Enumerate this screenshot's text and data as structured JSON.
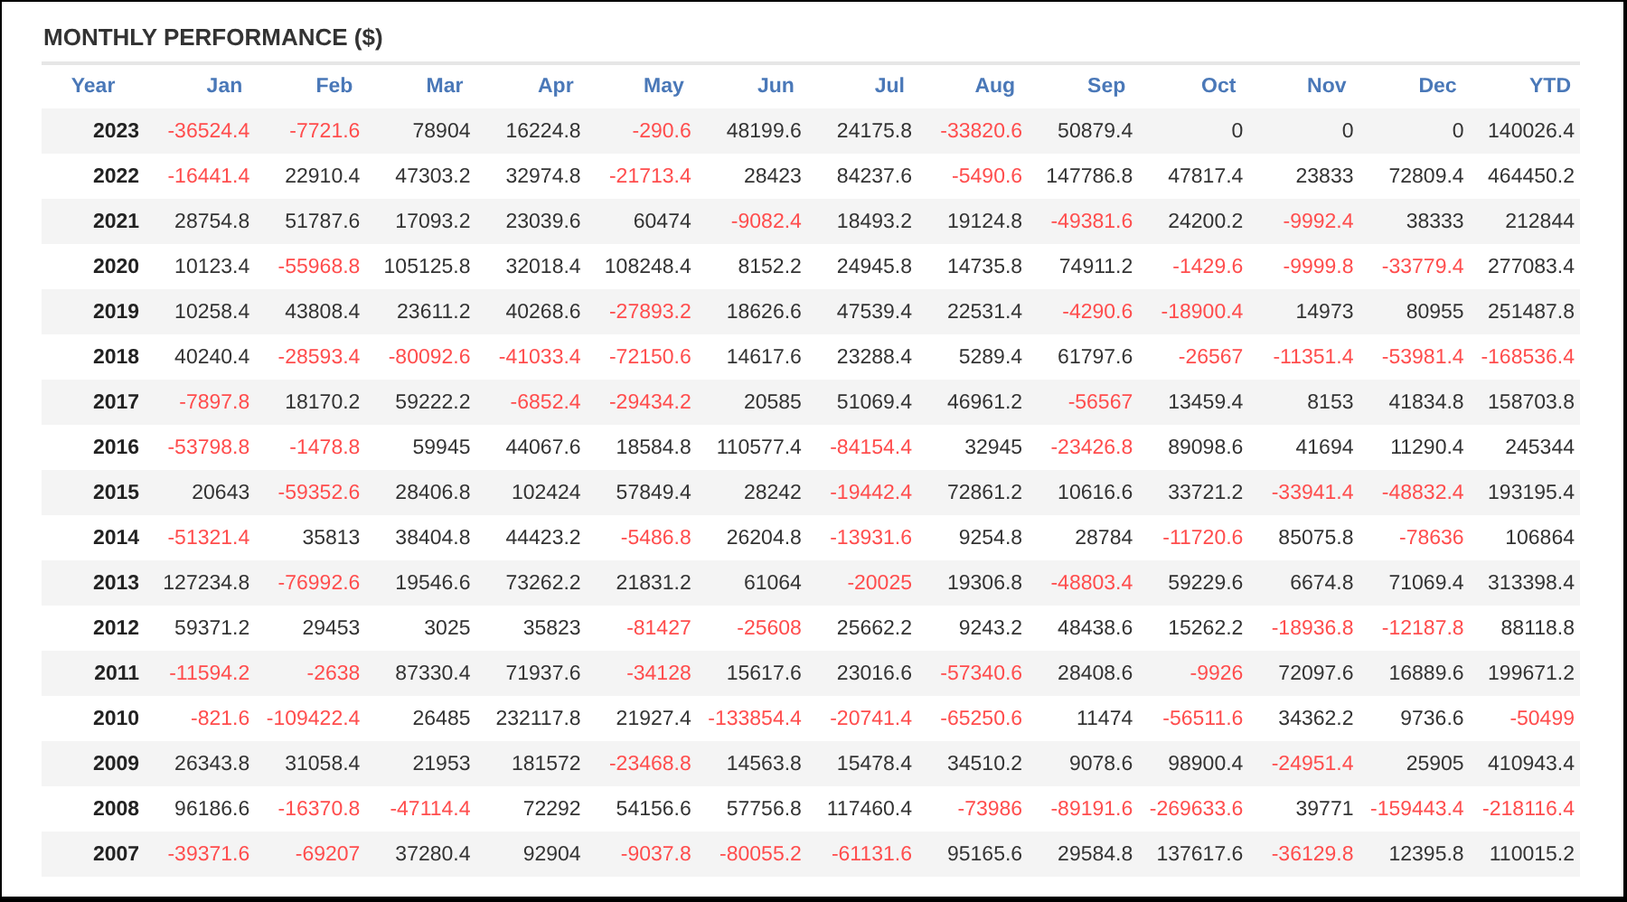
{
  "title": "MONTHLY PERFORMANCE ($)",
  "columns": [
    "Year",
    "Jan",
    "Feb",
    "Mar",
    "Apr",
    "May",
    "Jun",
    "Jul",
    "Aug",
    "Sep",
    "Oct",
    "Nov",
    "Dec",
    "YTD"
  ],
  "rows": [
    {
      "year": "2023",
      "cells": [
        {
          "text": "-36524.4",
          "negative": true
        },
        {
          "text": "-7721.6",
          "negative": true
        },
        {
          "text": "78904",
          "negative": false
        },
        {
          "text": "16224.8",
          "negative": false
        },
        {
          "text": "-290.6",
          "negative": true
        },
        {
          "text": "48199.6",
          "negative": false
        },
        {
          "text": "24175.8",
          "negative": false
        },
        {
          "text": "-33820.6",
          "negative": true
        },
        {
          "text": "50879.4",
          "negative": false
        },
        {
          "text": "0",
          "negative": false
        },
        {
          "text": "0",
          "negative": false
        },
        {
          "text": "0",
          "negative": false
        },
        {
          "text": "140026.4",
          "negative": false
        }
      ]
    },
    {
      "year": "2022",
      "cells": [
        {
          "text": "-16441.4",
          "negative": true
        },
        {
          "text": "22910.4",
          "negative": false
        },
        {
          "text": "47303.2",
          "negative": false
        },
        {
          "text": "32974.8",
          "negative": false
        },
        {
          "text": "-21713.4",
          "negative": true
        },
        {
          "text": "28423",
          "negative": false
        },
        {
          "text": "84237.6",
          "negative": false
        },
        {
          "text": "-5490.6",
          "negative": true
        },
        {
          "text": "147786.8",
          "negative": false
        },
        {
          "text": "47817.4",
          "negative": false
        },
        {
          "text": "23833",
          "negative": false
        },
        {
          "text": "72809.4",
          "negative": false
        },
        {
          "text": "464450.2",
          "negative": false
        }
      ]
    },
    {
      "year": "2021",
      "cells": [
        {
          "text": "28754.8",
          "negative": false
        },
        {
          "text": "51787.6",
          "negative": false
        },
        {
          "text": "17093.2",
          "negative": false
        },
        {
          "text": "23039.6",
          "negative": false
        },
        {
          "text": "60474",
          "negative": false
        },
        {
          "text": "-9082.4",
          "negative": true
        },
        {
          "text": "18493.2",
          "negative": false
        },
        {
          "text": "19124.8",
          "negative": false
        },
        {
          "text": "-49381.6",
          "negative": true
        },
        {
          "text": "24200.2",
          "negative": false
        },
        {
          "text": "-9992.4",
          "negative": true
        },
        {
          "text": "38333",
          "negative": false
        },
        {
          "text": "212844",
          "negative": false
        }
      ]
    },
    {
      "year": "2020",
      "cells": [
        {
          "text": "10123.4",
          "negative": false
        },
        {
          "text": "-55968.8",
          "negative": true
        },
        {
          "text": "105125.8",
          "negative": false
        },
        {
          "text": "32018.4",
          "negative": false
        },
        {
          "text": "108248.4",
          "negative": false
        },
        {
          "text": "8152.2",
          "negative": false
        },
        {
          "text": "24945.8",
          "negative": false
        },
        {
          "text": "14735.8",
          "negative": false
        },
        {
          "text": "74911.2",
          "negative": false
        },
        {
          "text": "-1429.6",
          "negative": true
        },
        {
          "text": "-9999.8",
          "negative": true
        },
        {
          "text": "-33779.4",
          "negative": true
        },
        {
          "text": "277083.4",
          "negative": false
        }
      ]
    },
    {
      "year": "2019",
      "cells": [
        {
          "text": "10258.4",
          "negative": false
        },
        {
          "text": "43808.4",
          "negative": false
        },
        {
          "text": "23611.2",
          "negative": false
        },
        {
          "text": "40268.6",
          "negative": false
        },
        {
          "text": "-27893.2",
          "negative": true
        },
        {
          "text": "18626.6",
          "negative": false
        },
        {
          "text": "47539.4",
          "negative": false
        },
        {
          "text": "22531.4",
          "negative": false
        },
        {
          "text": "-4290.6",
          "negative": true
        },
        {
          "text": "-18900.4",
          "negative": true
        },
        {
          "text": "14973",
          "negative": false
        },
        {
          "text": "80955",
          "negative": false
        },
        {
          "text": "251487.8",
          "negative": false
        }
      ]
    },
    {
      "year": "2018",
      "cells": [
        {
          "text": "40240.4",
          "negative": false
        },
        {
          "text": "-28593.4",
          "negative": true
        },
        {
          "text": "-80092.6",
          "negative": true
        },
        {
          "text": "-41033.4",
          "negative": true
        },
        {
          "text": "-72150.6",
          "negative": true
        },
        {
          "text": "14617.6",
          "negative": false
        },
        {
          "text": "23288.4",
          "negative": false
        },
        {
          "text": "5289.4",
          "negative": false
        },
        {
          "text": "61797.6",
          "negative": false
        },
        {
          "text": "-26567",
          "negative": true
        },
        {
          "text": "-11351.4",
          "negative": true
        },
        {
          "text": "-53981.4",
          "negative": true
        },
        {
          "text": "-168536.4",
          "negative": true
        }
      ]
    },
    {
      "year": "2017",
      "cells": [
        {
          "text": "-7897.8",
          "negative": true
        },
        {
          "text": "18170.2",
          "negative": false
        },
        {
          "text": "59222.2",
          "negative": false
        },
        {
          "text": "-6852.4",
          "negative": true
        },
        {
          "text": "-29434.2",
          "negative": true
        },
        {
          "text": "20585",
          "negative": false
        },
        {
          "text": "51069.4",
          "negative": false
        },
        {
          "text": "46961.2",
          "negative": false
        },
        {
          "text": "-56567",
          "negative": true
        },
        {
          "text": "13459.4",
          "negative": false
        },
        {
          "text": "8153",
          "negative": false
        },
        {
          "text": "41834.8",
          "negative": false
        },
        {
          "text": "158703.8",
          "negative": false
        }
      ]
    },
    {
      "year": "2016",
      "cells": [
        {
          "text": "-53798.8",
          "negative": true
        },
        {
          "text": "-1478.8",
          "negative": true
        },
        {
          "text": "59945",
          "negative": false
        },
        {
          "text": "44067.6",
          "negative": false
        },
        {
          "text": "18584.8",
          "negative": false
        },
        {
          "text": "110577.4",
          "negative": false
        },
        {
          "text": "-84154.4",
          "negative": true
        },
        {
          "text": "32945",
          "negative": false
        },
        {
          "text": "-23426.8",
          "negative": true
        },
        {
          "text": "89098.6",
          "negative": false
        },
        {
          "text": "41694",
          "negative": false
        },
        {
          "text": "11290.4",
          "negative": false
        },
        {
          "text": "245344",
          "negative": false
        }
      ]
    },
    {
      "year": "2015",
      "cells": [
        {
          "text": "20643",
          "negative": false
        },
        {
          "text": "-59352.6",
          "negative": true
        },
        {
          "text": "28406.8",
          "negative": false
        },
        {
          "text": "102424",
          "negative": false
        },
        {
          "text": "57849.4",
          "negative": false
        },
        {
          "text": "28242",
          "negative": false
        },
        {
          "text": "-19442.4",
          "negative": true
        },
        {
          "text": "72861.2",
          "negative": false
        },
        {
          "text": "10616.6",
          "negative": false
        },
        {
          "text": "33721.2",
          "negative": false
        },
        {
          "text": "-33941.4",
          "negative": true
        },
        {
          "text": "-48832.4",
          "negative": true
        },
        {
          "text": "193195.4",
          "negative": false
        }
      ]
    },
    {
      "year": "2014",
      "cells": [
        {
          "text": "-51321.4",
          "negative": true
        },
        {
          "text": "35813",
          "negative": false
        },
        {
          "text": "38404.8",
          "negative": false
        },
        {
          "text": "44423.2",
          "negative": false
        },
        {
          "text": "-5486.8",
          "negative": true
        },
        {
          "text": "26204.8",
          "negative": false
        },
        {
          "text": "-13931.6",
          "negative": true
        },
        {
          "text": "9254.8",
          "negative": false
        },
        {
          "text": "28784",
          "negative": false
        },
        {
          "text": "-11720.6",
          "negative": true
        },
        {
          "text": "85075.8",
          "negative": false
        },
        {
          "text": "-78636",
          "negative": true
        },
        {
          "text": "106864",
          "negative": false
        }
      ]
    },
    {
      "year": "2013",
      "cells": [
        {
          "text": "127234.8",
          "negative": false
        },
        {
          "text": "-76992.6",
          "negative": true
        },
        {
          "text": "19546.6",
          "negative": false
        },
        {
          "text": "73262.2",
          "negative": false
        },
        {
          "text": "21831.2",
          "negative": false
        },
        {
          "text": "61064",
          "negative": false
        },
        {
          "text": "-20025",
          "negative": true
        },
        {
          "text": "19306.8",
          "negative": false
        },
        {
          "text": "-48803.4",
          "negative": true
        },
        {
          "text": "59229.6",
          "negative": false
        },
        {
          "text": "6674.8",
          "negative": false
        },
        {
          "text": "71069.4",
          "negative": false
        },
        {
          "text": "313398.4",
          "negative": false
        }
      ]
    },
    {
      "year": "2012",
      "cells": [
        {
          "text": "59371.2",
          "negative": false
        },
        {
          "text": "29453",
          "negative": false
        },
        {
          "text": "3025",
          "negative": false
        },
        {
          "text": "35823",
          "negative": false
        },
        {
          "text": "-81427",
          "negative": true
        },
        {
          "text": "-25608",
          "negative": true
        },
        {
          "text": "25662.2",
          "negative": false
        },
        {
          "text": "9243.2",
          "negative": false
        },
        {
          "text": "48438.6",
          "negative": false
        },
        {
          "text": "15262.2",
          "negative": false
        },
        {
          "text": "-18936.8",
          "negative": true
        },
        {
          "text": "-12187.8",
          "negative": true
        },
        {
          "text": "88118.8",
          "negative": false
        }
      ]
    },
    {
      "year": "2011",
      "cells": [
        {
          "text": "-11594.2",
          "negative": true
        },
        {
          "text": "-2638",
          "negative": true
        },
        {
          "text": "87330.4",
          "negative": false
        },
        {
          "text": "71937.6",
          "negative": false
        },
        {
          "text": "-34128",
          "negative": true
        },
        {
          "text": "15617.6",
          "negative": false
        },
        {
          "text": "23016.6",
          "negative": false
        },
        {
          "text": "-57340.6",
          "negative": true
        },
        {
          "text": "28408.6",
          "negative": false
        },
        {
          "text": "-9926",
          "negative": true
        },
        {
          "text": "72097.6",
          "negative": false
        },
        {
          "text": "16889.6",
          "negative": false
        },
        {
          "text": "199671.2",
          "negative": false
        }
      ]
    },
    {
      "year": "2010",
      "cells": [
        {
          "text": "-821.6",
          "negative": true
        },
        {
          "text": "-109422.4",
          "negative": true
        },
        {
          "text": "26485",
          "negative": false
        },
        {
          "text": "232117.8",
          "negative": false
        },
        {
          "text": "21927.4",
          "negative": false
        },
        {
          "text": "-133854.4",
          "negative": true
        },
        {
          "text": "-20741.4",
          "negative": true
        },
        {
          "text": "-65250.6",
          "negative": true
        },
        {
          "text": "11474",
          "negative": false
        },
        {
          "text": "-56511.6",
          "negative": true
        },
        {
          "text": "34362.2",
          "negative": false
        },
        {
          "text": "9736.6",
          "negative": false
        },
        {
          "text": "-50499",
          "negative": true
        }
      ]
    },
    {
      "year": "2009",
      "cells": [
        {
          "text": "26343.8",
          "negative": false
        },
        {
          "text": "31058.4",
          "negative": false
        },
        {
          "text": "21953",
          "negative": false
        },
        {
          "text": "181572",
          "negative": false
        },
        {
          "text": "-23468.8",
          "negative": true
        },
        {
          "text": "14563.8",
          "negative": false
        },
        {
          "text": "15478.4",
          "negative": false
        },
        {
          "text": "34510.2",
          "negative": false
        },
        {
          "text": "9078.6",
          "negative": false
        },
        {
          "text": "98900.4",
          "negative": false
        },
        {
          "text": "-24951.4",
          "negative": true
        },
        {
          "text": "25905",
          "negative": false
        },
        {
          "text": "410943.4",
          "negative": false
        }
      ]
    },
    {
      "year": "2008",
      "cells": [
        {
          "text": "96186.6",
          "negative": false
        },
        {
          "text": "-16370.8",
          "negative": true
        },
        {
          "text": "-47114.4",
          "negative": true
        },
        {
          "text": "72292",
          "negative": false
        },
        {
          "text": "54156.6",
          "negative": false
        },
        {
          "text": "57756.8",
          "negative": false
        },
        {
          "text": "117460.4",
          "negative": false
        },
        {
          "text": "-73986",
          "negative": true
        },
        {
          "text": "-89191.6",
          "negative": true
        },
        {
          "text": "-269633.6",
          "negative": true
        },
        {
          "text": "39771",
          "negative": false
        },
        {
          "text": "-159443.4",
          "negative": true
        },
        {
          "text": "-218116.4",
          "negative": true
        }
      ]
    },
    {
      "year": "2007",
      "cells": [
        {
          "text": "-39371.6",
          "negative": true
        },
        {
          "text": "-69207",
          "negative": true
        },
        {
          "text": "37280.4",
          "negative": false
        },
        {
          "text": "92904",
          "negative": false
        },
        {
          "text": "-9037.8",
          "negative": true
        },
        {
          "text": "-80055.2",
          "negative": true
        },
        {
          "text": "-61131.6",
          "negative": true
        },
        {
          "text": "95165.6",
          "negative": false
        },
        {
          "text": "29584.8",
          "negative": false
        },
        {
          "text": "137617.6",
          "negative": false
        },
        {
          "text": "-36129.8",
          "negative": true
        },
        {
          "text": "12395.8",
          "negative": false
        },
        {
          "text": "110015.2",
          "negative": false
        }
      ]
    }
  ]
}
